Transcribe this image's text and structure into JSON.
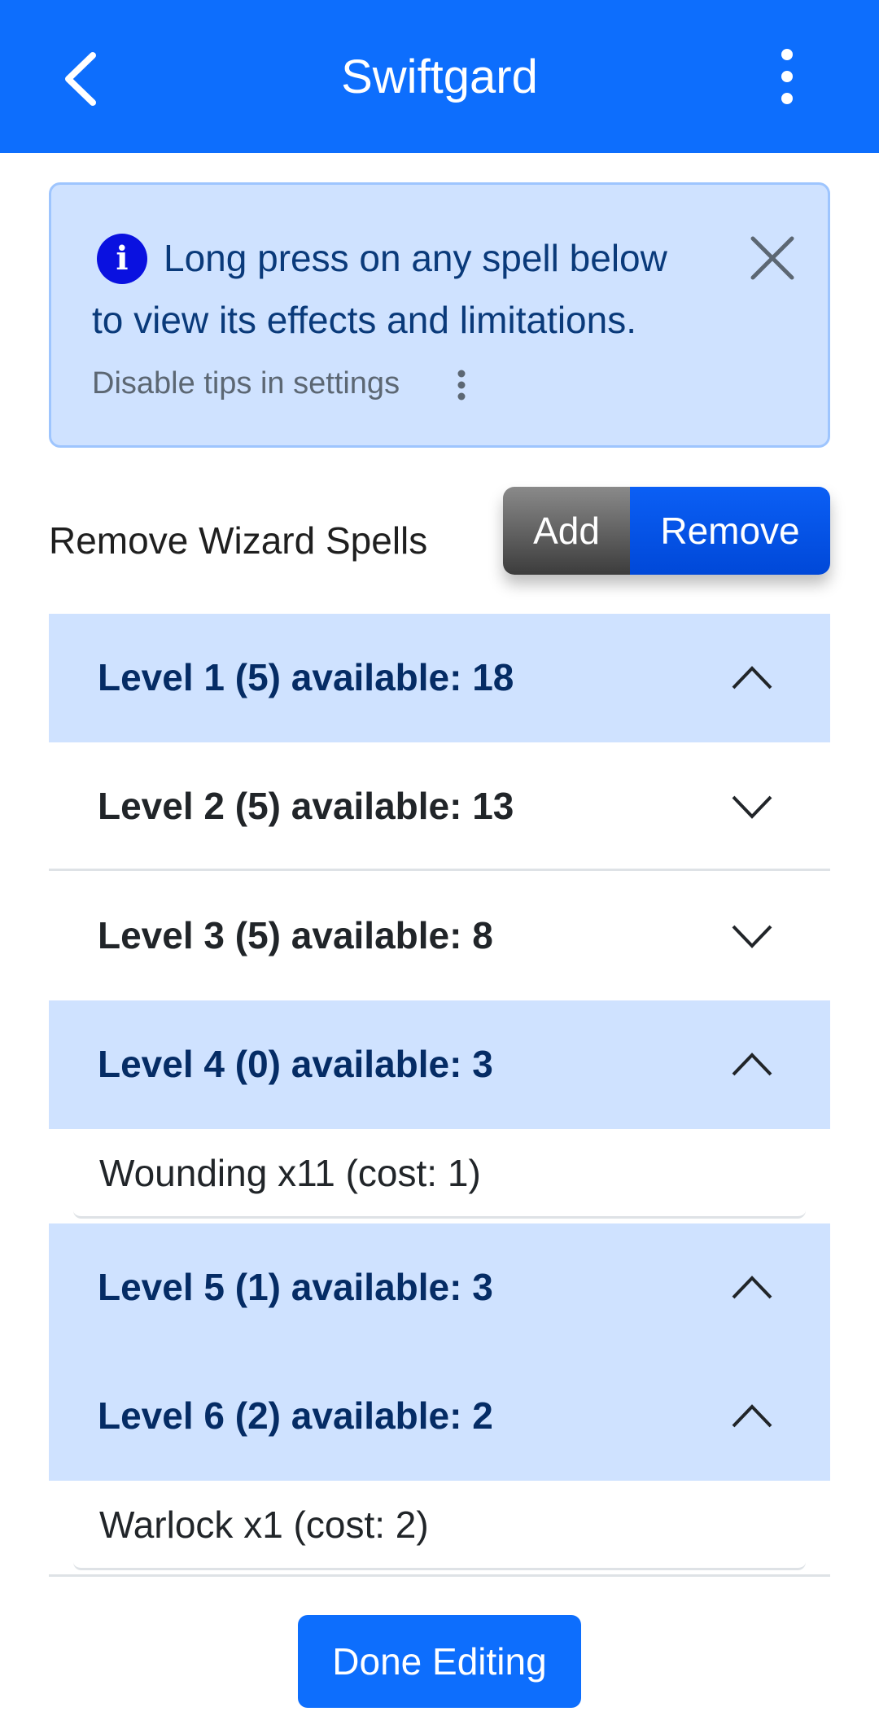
{
  "header": {
    "title": "Swiftgard",
    "back_icon": "chevron-left-icon",
    "menu_icon": "vertical-dots-icon"
  },
  "tip": {
    "line1": "Long press on any spell below",
    "line2": "to view its effects and limitations.",
    "sub": "Disable tips in settings",
    "info_icon_glyph": "i",
    "info_icon": "info-icon",
    "close_icon": "close-icon"
  },
  "spells_section": {
    "label": "Remove Wizard Spells",
    "toggle": {
      "add_label": "Add",
      "remove_label": "Remove",
      "selected": "Remove"
    }
  },
  "levels": [
    {
      "label": "Level 1 (5) available: 18",
      "expanded": true,
      "items": []
    },
    {
      "label": "Level 2 (5) available: 13",
      "expanded": false,
      "items": []
    },
    {
      "label": "Level 3 (5) available: 8",
      "expanded": false,
      "items": []
    },
    {
      "label": "Level 4 (0) available: 3",
      "expanded": true,
      "items": [
        "Wounding x11 (cost: 1)"
      ]
    },
    {
      "label": "Level 5 (1) available: 3",
      "expanded": true,
      "items": []
    },
    {
      "label": "Level 6 (2) available: 2",
      "expanded": true,
      "items": [
        "Warlock x1 (cost: 2)"
      ]
    }
  ],
  "footer": {
    "done_label": "Done Editing"
  },
  "colors": {
    "primary": "#0d6efd",
    "accordion_open_bg": "#cfe2ff",
    "accordion_open_text": "#052c65",
    "info_icon": "#0a11e0"
  }
}
